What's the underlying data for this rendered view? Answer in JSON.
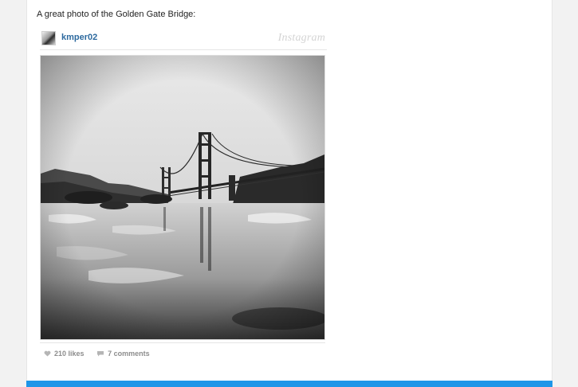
{
  "post": {
    "intro_text": "A great photo of the Golden Gate Bridge:"
  },
  "instagram_embed": {
    "username": "kmper02",
    "logo_text": "Instagram",
    "likes_label": "210 likes",
    "comments_label": "7 comments"
  },
  "colors": {
    "username": "#2d6a9f",
    "accent_bar": "#1e96e8",
    "background": "#f2f2f2"
  },
  "icons": {
    "likes": "heart-icon",
    "comments": "speech-bubble-icon"
  }
}
